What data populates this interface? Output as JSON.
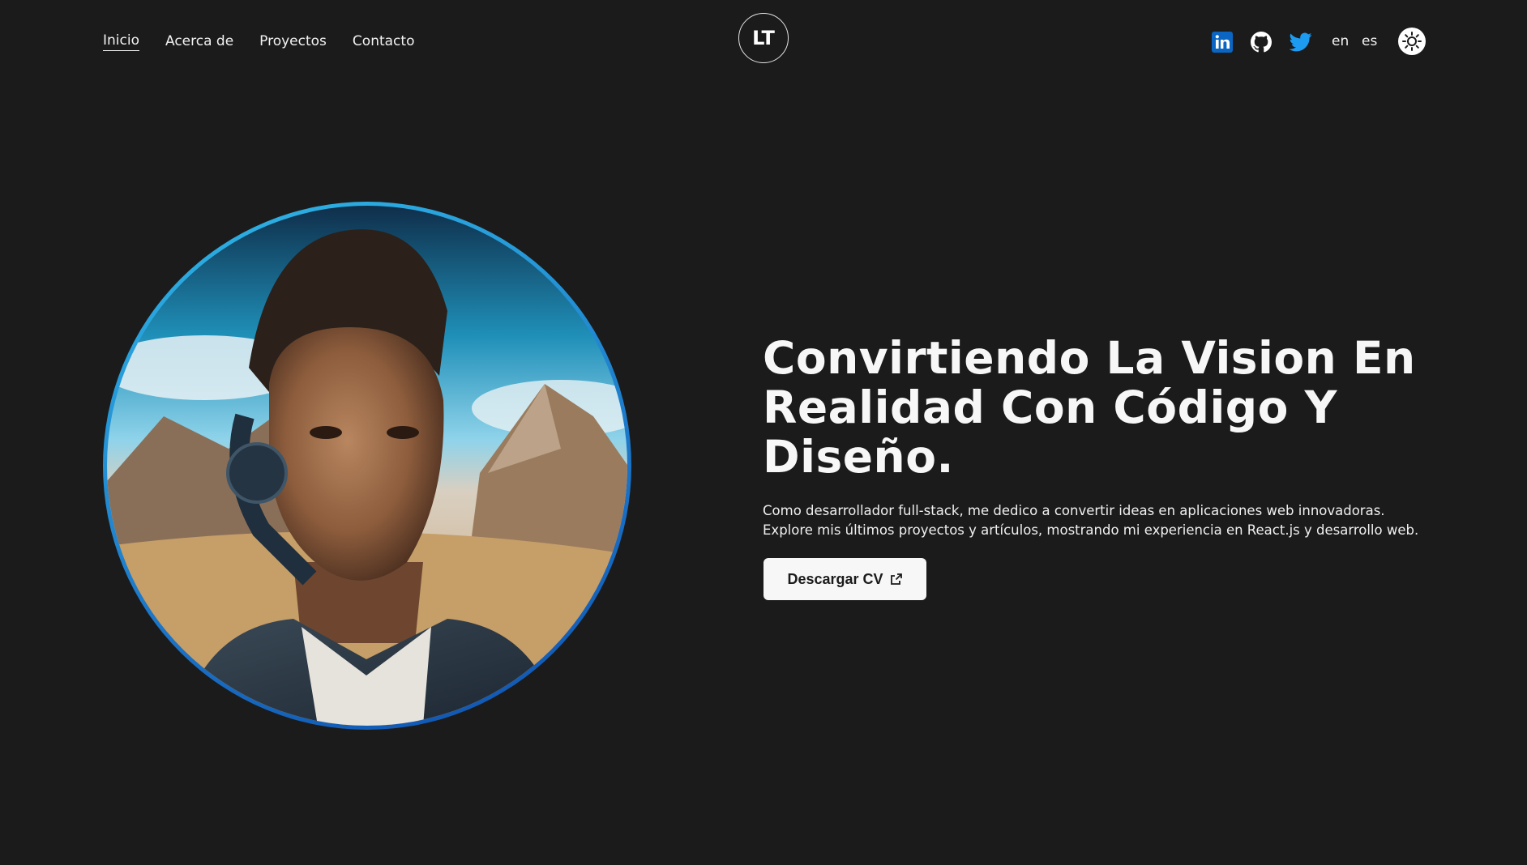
{
  "nav": {
    "items": [
      {
        "label": "Inicio"
      },
      {
        "label": "Acerca de"
      },
      {
        "label": "Proyectos"
      },
      {
        "label": "Contacto"
      }
    ]
  },
  "logo": {
    "text": "LT"
  },
  "social": {
    "icons": [
      "linkedin-icon",
      "github-icon",
      "twitter-icon"
    ],
    "colors": {
      "linkedin": "#0a66c2",
      "github": "#ffffff",
      "twitter": "#1d9bf0"
    }
  },
  "languages": [
    "en",
    "es"
  ],
  "theme_toggle": {
    "icon": "sun-icon"
  },
  "hero": {
    "title": "Convirtiendo La Vision En Realidad Con Código Y Diseño.",
    "description": "Como desarrollador full-stack, me dedico a convertir ideas en aplicaciones web innovadoras. Explore mis últimos proyectos y artículos, mostrando mi experiencia en React.js y desarrollo web.",
    "cta_label": "Descargar CV",
    "cta_icon": "external-link-icon"
  },
  "colors": {
    "background": "#1b1b1b",
    "text": "#ffffff",
    "avatar_ring": "#1c77c9",
    "button_bg": "#f7f7f7"
  }
}
